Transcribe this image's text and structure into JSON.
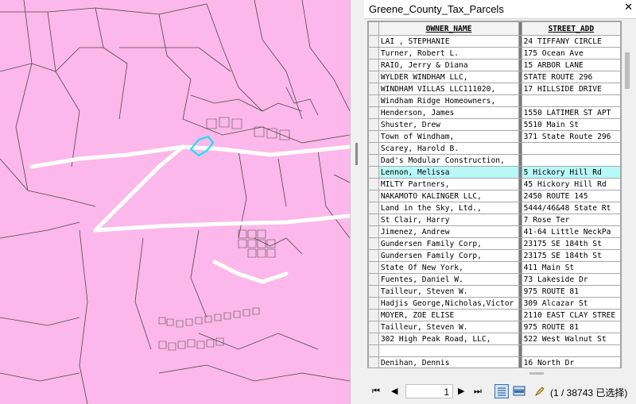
{
  "window": {
    "title": "Greene_County_Tax_Parcels",
    "close_glyph": "✕"
  },
  "table": {
    "columns": [
      "OWNER_NAME",
      "STREET_ADD"
    ],
    "rows": [
      [
        "LAI , STEPHANIE",
        "24 TIFFANY CIRCLE"
      ],
      [
        "Turner, Robert L.",
        "175 Ocean Ave"
      ],
      [
        "RAIO, Jerry & Diana",
        "15 ARBOR LANE"
      ],
      [
        "WYLDER WINDHAM LLC,",
        "STATE ROUTE 296"
      ],
      [
        "WINDHAM VILLAS LLC111020,",
        "17 HILLSIDE DRIVE"
      ],
      [
        "Windham Ridge Homeowners,",
        ""
      ],
      [
        "Henderson, James",
        "1550 LATIMER ST APT"
      ],
      [
        "Shuster, Drew",
        "5510 Main St"
      ],
      [
        "Town of Windham,",
        "371 State Route 296"
      ],
      [
        "Scarey, Harold B.",
        ""
      ],
      [
        "Dad's Modular Construction,",
        ""
      ],
      [
        "Lennon, Melissa",
        "5 Hickory Hill Rd"
      ],
      [
        "MILTY Partners,",
        "45 Hickory Hill Rd"
      ],
      [
        "NAKAMOTO KALINGER LLC,",
        "2450 ROUTE 145"
      ],
      [
        "Land in the Sky, Ltd.,",
        "5444/46&48 State Rt"
      ],
      [
        "St Clair, Harry",
        "7 Rose Ter"
      ],
      [
        "Jimenez, Andrew",
        "41-64 Little NeckPa"
      ],
      [
        "Gundersen Family Corp,",
        "23175 SE 184th St"
      ],
      [
        "Gundersen Family Corp,",
        "23175 SE 184th St"
      ],
      [
        "State Of New York,",
        "411 Main St"
      ],
      [
        "Fuentes, Daniel W.",
        "73 Lakeside Dr"
      ],
      [
        "Tailleur, Steven W.",
        "975 ROUTE 81"
      ],
      [
        "Hadjis George,Nicholas,Victor",
        "309 Alcazar St"
      ],
      [
        "MOYER, ZOE ELISE",
        "2110 EAST CLAY STREE"
      ],
      [
        "Tailleur, Steven W.",
        "975 ROUTE 81"
      ],
      [
        "302 High Peak Road, LLC,",
        "522 West Walnut St"
      ],
      [
        "",
        ""
      ],
      [
        "Denihan, Dennis",
        "16 North Dr"
      ]
    ],
    "highlighted_row": 11
  },
  "nav": {
    "first": "⏮",
    "prev": "◀",
    "page": "1",
    "next": "▶",
    "last": "⏭",
    "status": "(1 / 38743 已选择)"
  },
  "colors": {
    "map_bg": "#fcb8ea",
    "selection": "#00e8f0",
    "row_highlight": "#b8f8f8"
  }
}
